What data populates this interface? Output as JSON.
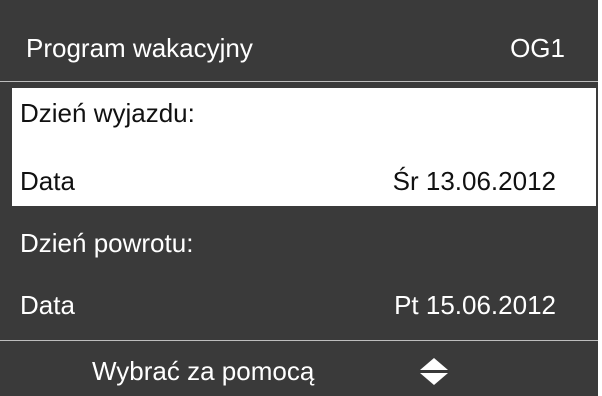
{
  "header": {
    "title": "Program wakacyjny",
    "code": "OG1"
  },
  "departure": {
    "label": "Dzień wyjazdu:",
    "date_label": "Data",
    "date_value": "Śr 13.06.2012"
  },
  "return": {
    "label": "Dzień powrotu:",
    "date_label": "Data",
    "date_value": "Pt 15.06.2012"
  },
  "footer": {
    "hint": "Wybrać za pomocą",
    "icon": "up-down-arrows-icon"
  },
  "colors": {
    "panel_bg": "#3a3a3a",
    "highlight_bg": "#ffffff",
    "text_light": "#ffffff",
    "text_dark": "#111111",
    "divider": "#bdbdbd"
  }
}
